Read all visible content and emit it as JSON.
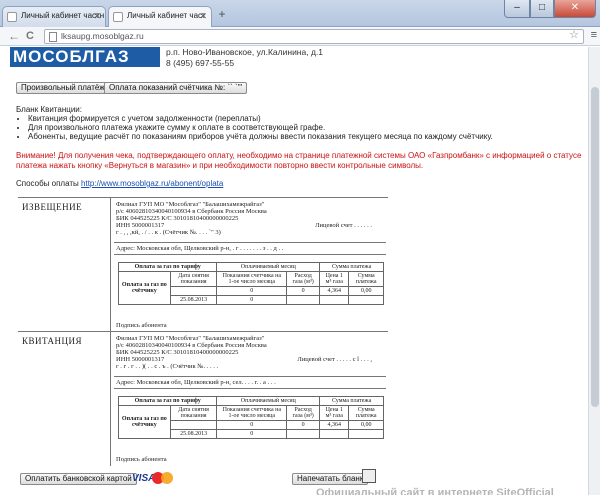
{
  "browser": {
    "tabs": [
      {
        "title": "Личный кабинет частн"
      },
      {
        "title": "Личный кабинет част"
      }
    ],
    "url": "lksaupg.mosoblgaz.ru",
    "page_title": "Личный кабинет частного абонента",
    "new_tab": "+",
    "win_min": "–",
    "win_max": "□",
    "win_close": "✕",
    "back": "←",
    "reload": "C",
    "star": "☆",
    "menu": "≡"
  },
  "header": {
    "logo": "МОСОБЛГАЗ",
    "address_line1": "р.п. Ново-Ивановское, ул.Калинина, д.1",
    "address_line2": "8 (495) 697-55-55"
  },
  "actions": {
    "arbitrary_payment": "Произвольный платёж",
    "meter_payment": "Оплата показаний счётчика №: `` `'\""
  },
  "blank": {
    "title": "Бланк Квитанции:",
    "items": [
      "Квитанция формируется с учетом задолженности (переплаты)",
      "Для произвольного платежа укажите сумму к оплате в соответствующей графе.",
      "Абоненты, ведущие расчёт по показаниям приборов учёта должны ввести показания текущего месяца по каждому счётчику."
    ]
  },
  "warning": "Внимание! Для получения чека, подтверждающего оплату, необходимо на странице платежной системы ОАО «Газпромбанк» с информацией о статусе платежа нажать кнопку «Вернуться в магазин» и при необходимости повторно ввести контрольные символы.",
  "payment": {
    "label": "Способы оплаты",
    "link": "http://www.mosoblgaz.ru/abonent/oplata"
  },
  "receipts": [
    {
      "label": "ИЗВЕЩЕНИЕ",
      "lines": [
        "Филиал ГУП МО \"Мособлгаз\" \"Балашихамежрайгаз\"",
        "р/с 40602810340040100934 в Сбербанк Россия Москва",
        "БИК 044525225 К/С 30101810400000000225",
        "ИНН 5000001317"
      ],
      "account": "Лицевой счет . . . . . .",
      "meter": "г . , , ,кй, . / . . к . (Счётчик №. . . . `\" 3)",
      "address": "Адрес: Московская обл, Щелковский р-н, . г . . . . . . . з . . д . .",
      "sign": "Подпись абонента"
    },
    {
      "label": "КВИТАНЦИЯ",
      "lines": [
        "Филиал ГУП МО \"Мособлгаз\" \"Балашихамежрайгаз\"",
        "р/с 40602810340040100934 в Сбербанк Россия Москва",
        "БИК 044525225 К/С 30101810400000000225",
        "ИНН 5000001317"
      ],
      "account": "Лицевой счет . . . . . c l . . . ,",
      "meter": "г . г . г . . )( . . с . ъ . (Счётчик №. . . . . ",
      "address": "Адрес: Московская обл, Щелковский р-н, сел. . . . г. . а . . .",
      "sign": "Подпись абонента"
    }
  ],
  "table": {
    "h_gas": "Оплата за газ по тарифу",
    "h_paid_month": "Оплачиваемый месяц",
    "h_sum": "Сумма платежа",
    "c_pay": "Оплата за газ по счётчику",
    "c_date": "Дата снятия показания",
    "c_readings": "Показания счетчика на 1-ое число месяца",
    "c_usage": "Расход газа (м³)",
    "c_price": "Цена 1 м³ газа",
    "c_sum": "Сумма платежа",
    "r1_reading": "0",
    "r1_usage": "0",
    "r1_price": "4,364",
    "r1_sum": "0,00",
    "r2_date": "25.08.2013",
    "r2_reading": "0"
  },
  "footer": {
    "bank_card": "Оплатить банковской картой",
    "visa": "VISA",
    "print": "Напечатать бланк",
    "watermark": "Официальный сайт в интернете SiteOfficial"
  },
  "colors": {
    "logo_bg": "#1e5da5",
    "warning": "#cc1111",
    "link": "#1a4fb0"
  }
}
